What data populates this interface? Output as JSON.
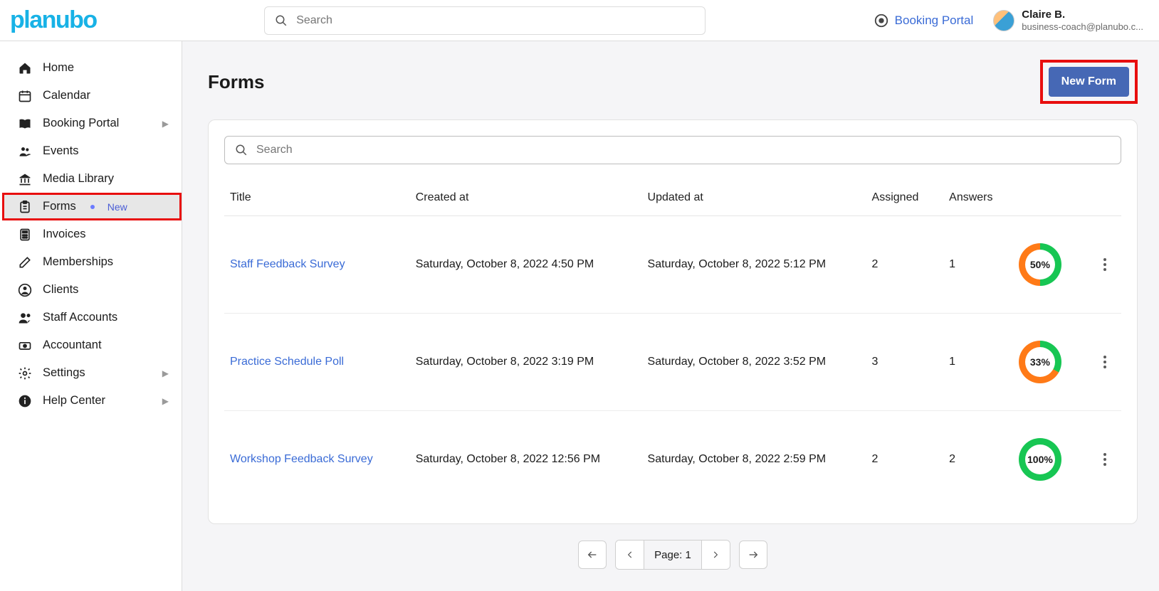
{
  "header": {
    "logo_text": "planubo",
    "search_placeholder": "Search",
    "booking_portal_label": "Booking Portal",
    "user": {
      "name": "Claire B.",
      "email": "business-coach@planubo.c..."
    }
  },
  "sidebar": {
    "items": [
      {
        "label": "Home"
      },
      {
        "label": "Calendar"
      },
      {
        "label": "Booking Portal"
      },
      {
        "label": "Events"
      },
      {
        "label": "Media Library"
      },
      {
        "label": "Forms",
        "badge": "New"
      },
      {
        "label": "Invoices"
      },
      {
        "label": "Memberships"
      },
      {
        "label": "Clients"
      },
      {
        "label": "Staff Accounts"
      },
      {
        "label": "Accountant"
      },
      {
        "label": "Settings"
      },
      {
        "label": "Help Center"
      }
    ]
  },
  "main": {
    "title": "Forms",
    "new_form_label": "New Form",
    "table_search_placeholder": "Search",
    "columns": {
      "title": "Title",
      "created": "Created at",
      "updated": "Updated at",
      "assigned": "Assigned",
      "answers": "Answers"
    },
    "rows": [
      {
        "title": "Staff Feedback Survey",
        "created": "Saturday, October 8, 2022 4:50 PM",
        "updated": "Saturday, October 8, 2022 5:12 PM",
        "assigned": "2",
        "answers": "1",
        "pct": "50%",
        "pct_num": 50
      },
      {
        "title": "Practice Schedule Poll",
        "created": "Saturday, October 8, 2022 3:19 PM",
        "updated": "Saturday, October 8, 2022 3:52 PM",
        "assigned": "3",
        "answers": "1",
        "pct": "33%",
        "pct_num": 33
      },
      {
        "title": "Workshop Feedback Survey",
        "created": "Saturday, October 8, 2022 12:56 PM",
        "updated": "Saturday, October 8, 2022 2:59 PM",
        "assigned": "2",
        "answers": "2",
        "pct": "100%",
        "pct_num": 100
      }
    ],
    "pager": {
      "label": "Page: 1"
    }
  }
}
